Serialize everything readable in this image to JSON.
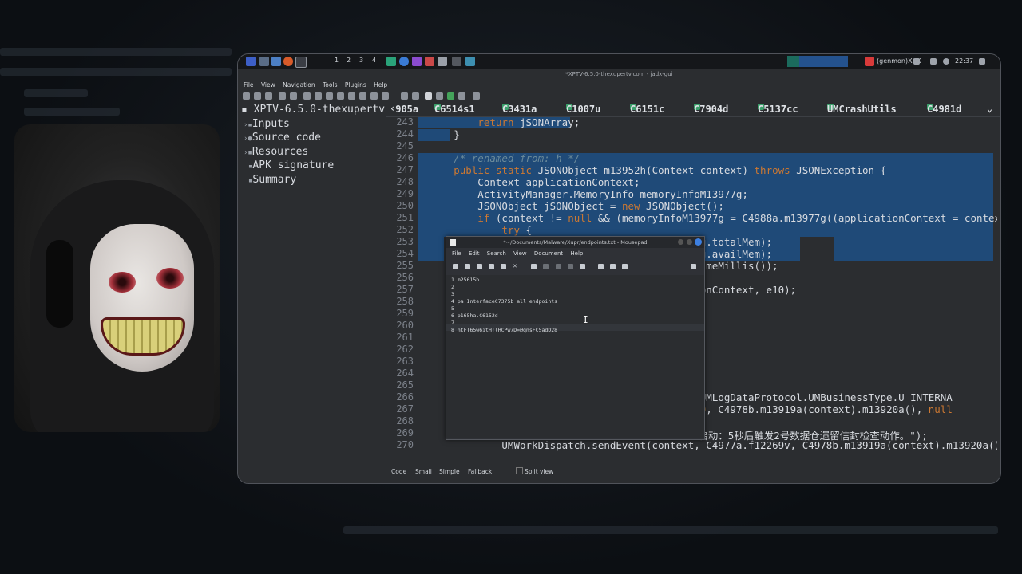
{
  "panel": {
    "workspaces": [
      "1",
      "2",
      "3",
      "4"
    ],
    "status_right": "(genmon)XXX",
    "clock": "22:37"
  },
  "window_title": "*XPTV-6.5.0-thexupertv.com - jadx-gui",
  "menubar": [
    "File",
    "View",
    "Navigation",
    "Tools",
    "Plugins",
    "Help"
  ],
  "tree": {
    "root": "XPTV-6.5.0-thexupertv",
    "items": [
      "Inputs",
      "Source code",
      "Resources",
      "APK signature",
      "Summary"
    ]
  },
  "tabs": [
    "905a",
    "C6514s1",
    "C3431a",
    "C1007u",
    "C6151c",
    "C7904d",
    "C5137cc",
    "UMCrashUtils",
    "C4981d"
  ],
  "code_lines": [
    {
      "n": "243",
      "t": "            return jSONArray;"
    },
    {
      "n": "244",
      "t": "        }"
    },
    {
      "n": "245",
      "t": ""
    },
    {
      "n": "246",
      "t": "        /* renamed from: h */"
    },
    {
      "n": "247",
      "t": "        public static JSONObject m13952h(Context context) throws JSONException {"
    },
    {
      "n": "248",
      "t": "            Context applicationContext;"
    },
    {
      "n": "249",
      "t": "            ActivityManager.MemoryInfo memoryInfoM13977g;"
    },
    {
      "n": "250",
      "t": "            JSONObject jSONObject = new JSONObject();"
    },
    {
      "n": "251",
      "t": "            if (context != null && (memoryInfoM13977g = C4988a.m13977g((applicationContext = context"
    },
    {
      "n": "252",
      "t": "                try {"
    },
    {
      "n": "253",
      "t": "                                            13977g.totalMem);"
    },
    {
      "n": "254",
      "t": "                                            13977g.availMem);"
    },
    {
      "n": "255",
      "t": "                                            rentTimeMillis());"
    },
    {
      "n": "256",
      "t": ""
    },
    {
      "n": "257",
      "t": "                                            icationContext, e10);"
    },
    {
      "n": "258",
      "t": ""
    },
    {
      "n": "259",
      "t": ""
    },
    {
      "n": "260",
      "t": ""
    },
    {
      "n": "261",
      "t": ""
    },
    {
      "n": "262",
      "t": ""
    },
    {
      "n": "263",
      "t": ""
    },
    {
      "n": "264",
      "t": "                                            ) {"
    },
    {
      "n": "265",
      "t": ""
    },
    {
      "n": "266",
      "t": "                                          ntext, UMLogDataProtocol.UMBusinessType.U_INTERNA"
    },
    {
      "n": "267",
      "t": "                                          t, 32769, C4978b.m13919a(context).m13920a(), null"
    },
    {
      "n": "268",
      "t": ""
    },
    {
      "n": "269",
      "t": "                                        --->>> 冷启动：5秒后触发2号数据仓遗留信封检查动作。\");"
    },
    {
      "n": "270",
      "t": "                UMWorkDispatch.sendEvent(context, C4977a.f12269v, C4978b.m13919a(context).m13920a(),"
    }
  ],
  "bottom_tabs": [
    "Code",
    "Smali",
    "Simple",
    "Fallback"
  ],
  "split_view": "Split view",
  "mousepad": {
    "title": "*~/Documents/Malware/Xupr/endpoints.txt - Mousepad",
    "menu": [
      "File",
      "Edit",
      "Search",
      "View",
      "Document",
      "Help"
    ],
    "lines": [
      {
        "n": "1",
        "t": "m25615b"
      },
      {
        "n": "2",
        "t": ""
      },
      {
        "n": "3",
        "t": ""
      },
      {
        "n": "4",
        "t": "pa.InterfaceC7375b all endpoints"
      },
      {
        "n": "5",
        "t": ""
      },
      {
        "n": "6",
        "t": "p165ha.C6152d"
      },
      {
        "n": "7",
        "t": ""
      },
      {
        "n": "8",
        "t": "ntFT65w6itH!lHCPw7D=@qnsFC5adD28"
      }
    ]
  }
}
